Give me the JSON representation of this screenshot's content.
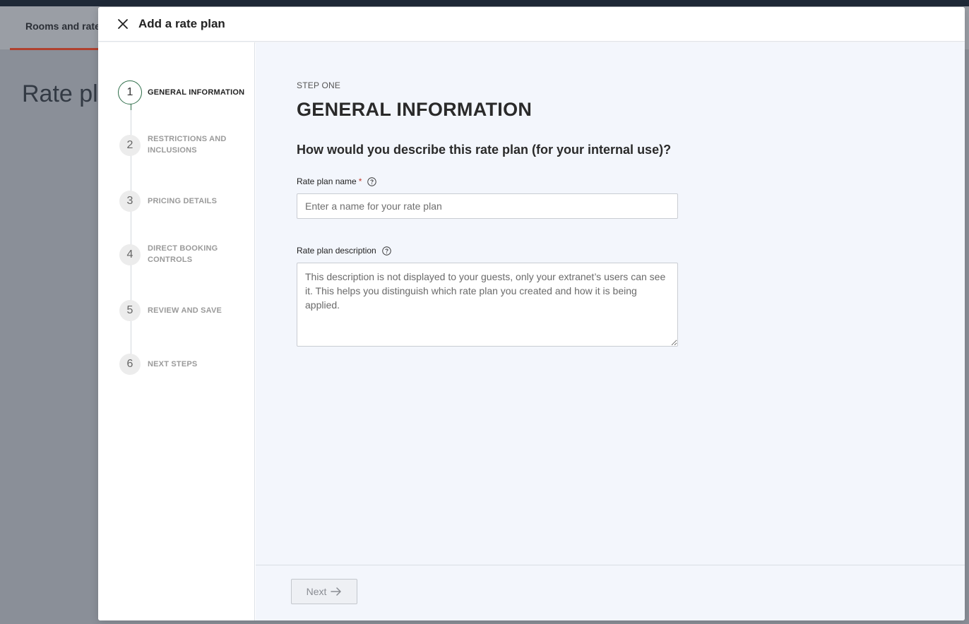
{
  "background": {
    "tab_label": "Rooms and rates",
    "page_title": "Rate plans"
  },
  "modal": {
    "title": "Add a rate plan",
    "close_icon": "close-icon"
  },
  "stepper": {
    "steps": [
      {
        "number": "1",
        "label": "GENERAL INFORMATION",
        "state": "active"
      },
      {
        "number": "2",
        "label": "RESTRICTIONS AND INCLUSIONS",
        "state": "upcoming"
      },
      {
        "number": "3",
        "label": "PRICING DETAILS",
        "state": "upcoming"
      },
      {
        "number": "4",
        "label": "DIRECT BOOKING CONTROLS",
        "state": "upcoming"
      },
      {
        "number": "5",
        "label": "REVIEW AND SAVE",
        "state": "upcoming"
      },
      {
        "number": "6",
        "label": "NEXT STEPS",
        "state": "upcoming"
      }
    ]
  },
  "main": {
    "kicker": "STEP ONE",
    "heading": "GENERAL INFORMATION",
    "question": "How would you describe this rate plan (for your internal use)?",
    "name_field": {
      "label": "Rate plan name",
      "required_mark": "*",
      "placeholder": "Enter a name for your rate plan",
      "value": ""
    },
    "description_field": {
      "label": "Rate plan description",
      "placeholder": "This description is not displayed to your guests, only your extranet’s users can see it. This helps you distinguish which rate plan you created and how it is being applied.",
      "value": ""
    }
  },
  "footer": {
    "next_label": "Next",
    "next_icon": "arrow-right-icon",
    "next_enabled": false
  },
  "colors": {
    "accent_green": "#2f6e4a",
    "required_red": "#c0392b",
    "tab_underline": "#b0412e"
  }
}
